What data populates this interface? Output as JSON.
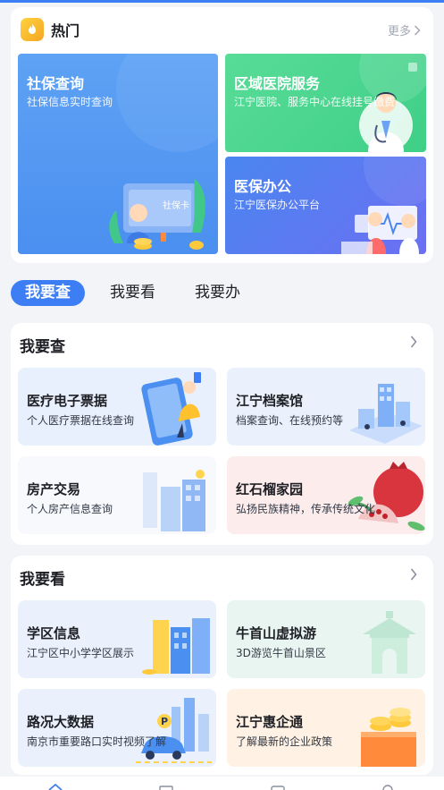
{
  "hot": {
    "title": "热门",
    "more": "更多",
    "tiles": [
      {
        "title": "社保查询",
        "subtitle": "社保信息实时查询",
        "card_text": "社保卡"
      },
      {
        "title": "区域医院服务",
        "subtitle": "江宁医院、服务中心在线挂号缴费"
      },
      {
        "title": "医保办公",
        "subtitle": "江宁医保办公平台"
      }
    ]
  },
  "tabs": [
    "我要查",
    "我要看",
    "我要办"
  ],
  "sections": [
    {
      "title": "我要查",
      "items": [
        {
          "title": "医疗电子票据",
          "subtitle": "个人医疗票据在线查询"
        },
        {
          "title": "江宁档案馆",
          "subtitle": "档案查询、在线预约等"
        },
        {
          "title": "房产交易",
          "subtitle": "个人房产信息查询"
        },
        {
          "title": "红石榴家园",
          "subtitle": "弘扬民族精神，传承传统文化"
        }
      ]
    },
    {
      "title": "我要看",
      "items": [
        {
          "title": "学区信息",
          "subtitle": "江宁区中小学学区展示"
        },
        {
          "title": "牛首山虚拟游",
          "subtitle": "3D游览牛首山景区"
        },
        {
          "title": "路况大数据",
          "subtitle": "南京市重要路口实时视频了解"
        },
        {
          "title": "江宁惠企通",
          "subtitle": "了解最新的企业政策"
        }
      ]
    }
  ]
}
